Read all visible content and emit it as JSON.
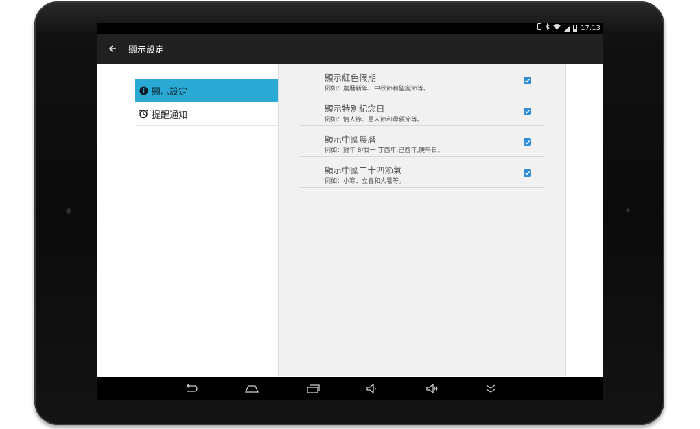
{
  "status_bar": {
    "time": "17:13"
  },
  "app_bar": {
    "title": "顯示設定"
  },
  "sidebar": {
    "items": [
      {
        "label": "顯示設定",
        "icon": "info-icon",
        "active": true
      },
      {
        "label": "提醒通知",
        "icon": "alarm-clock-icon",
        "active": false
      }
    ]
  },
  "preferences": [
    {
      "title": "顯示紅色假期",
      "summary": "例如：農曆新年、中秋節和聖誕節等。",
      "checked": true
    },
    {
      "title": "顯示特別紀念日",
      "summary": "例如：情人節、愚人節和母親節等。",
      "checked": true
    },
    {
      "title": "顯示中國農曆",
      "summary": "例如：雞年 8/廿一 丁酉年,己酉年,庚午日。",
      "checked": true
    },
    {
      "title": "顯示中國二十四節氣",
      "summary": "例如：小寒、立春和大暑等。",
      "checked": true
    }
  ],
  "nav_bar": {
    "buttons": [
      "back-icon",
      "home-icon",
      "recents-icon",
      "volume-down-icon",
      "volume-up-icon",
      "collapse-icon"
    ]
  },
  "colors": {
    "accent": "#29a9d4",
    "checkbox": "#2f8fd6",
    "app_bar": "#212121"
  }
}
